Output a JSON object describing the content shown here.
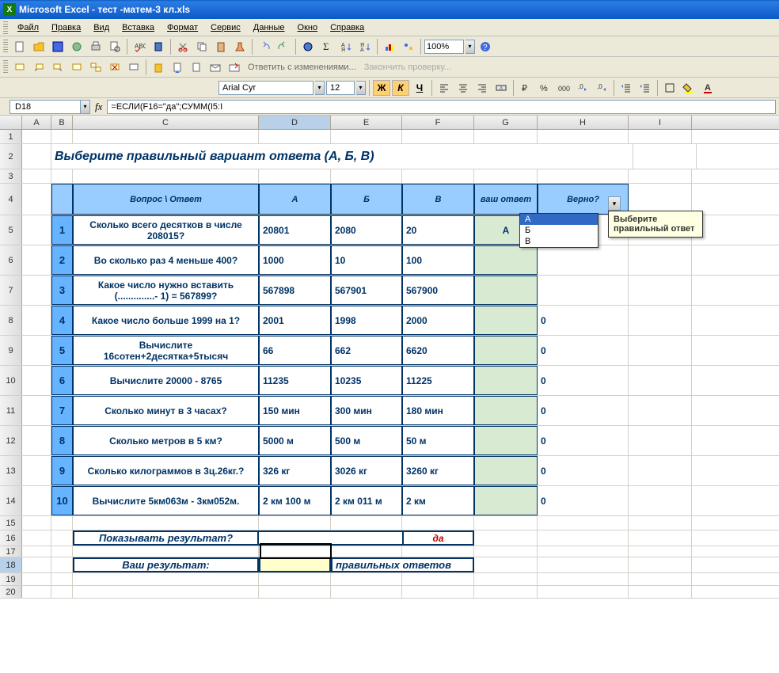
{
  "title": "Microsoft Excel - тест -матем-3 кл.xls",
  "menus": [
    "Файл",
    "Правка",
    "Вид",
    "Вставка",
    "Формат",
    "Сервис",
    "Данные",
    "Окно",
    "Справка"
  ],
  "zoom": "100%",
  "review": {
    "reply": "Ответить с изменениями...",
    "end": "Закончить проверку..."
  },
  "format": {
    "font": "Arial Cyr",
    "size": "12",
    "bold": "Ж",
    "italic": "К",
    "underline": "Ч"
  },
  "namebox": "D18",
  "formula": "=ЕСЛИ(F16=\"да\";СУММ(I5:I",
  "cols": [
    "A",
    "B",
    "C",
    "D",
    "E",
    "F",
    "G",
    "H",
    "I"
  ],
  "sheet_title": "Выберите правильный вариант ответа (А, Б, В)",
  "headers": {
    "q": "Вопрос   \\   Ответ",
    "a": "А",
    "b": "Б",
    "c": "В",
    "your": "ваш ответ",
    "correct": "Верно?"
  },
  "rows": [
    {
      "n": "1",
      "q": "Сколько всего десятков в числе 208015?",
      "a": "20801",
      "b": "2080",
      "c": "20",
      "your": "А",
      "correct": ""
    },
    {
      "n": "2",
      "q": "Во сколько раз 4 меньше 400?",
      "a": "1000",
      "b": "10",
      "c": "100",
      "your": "",
      "correct": ""
    },
    {
      "n": "3",
      "q": "Какое число нужно вставить (..............- 1) = 567899?",
      "a": "567898",
      "b": "567901",
      "c": "567900",
      "your": "",
      "correct": ""
    },
    {
      "n": "4",
      "q": "Какое число больше 1999 на 1?",
      "a": "2001",
      "b": "1998",
      "c": "2000",
      "your": "",
      "correct": "0"
    },
    {
      "n": "5",
      "q": "Вычислите 16сотен+2десятка+5тысяч",
      "a": "66",
      "b": "662",
      "c": "6620",
      "your": "",
      "correct": "0"
    },
    {
      "n": "6",
      "q": "Вычислите   20000 - 8765",
      "a": "11235",
      "b": "10235",
      "c": "11225",
      "your": "",
      "correct": "0"
    },
    {
      "n": "7",
      "q": "Сколько минут в 3 часах?",
      "a": "150 мин",
      "b": " 300 мин",
      "c": "180 мин",
      "your": "",
      "correct": "0"
    },
    {
      "n": "8",
      "q": "Сколько метров в 5 км?",
      "a": "5000 м",
      "b": "500 м",
      "c": " 50 м",
      "your": "",
      "correct": "0"
    },
    {
      "n": "9",
      "q": "Сколько килограммов в 3ц.26кг.?",
      "a": " 326 кг",
      "b": "3026 кг",
      "c": "3260 кг",
      "your": "",
      "correct": "0"
    },
    {
      "n": "10",
      "q": "Вычислите 5км063м - 3км052м.",
      "a": "2 км 100 м",
      "b": "2 км 011 м",
      "c": "2 км",
      "your": "",
      "correct": "0"
    }
  ],
  "show_result_label": "Показывать результат?",
  "show_result_val": "да",
  "your_result_label": "Ваш результат:",
  "your_result_text": "правильных ответов",
  "dropdown_opts": [
    "А",
    "Б",
    "В"
  ],
  "tooltip": "Выберите правильный ответ"
}
